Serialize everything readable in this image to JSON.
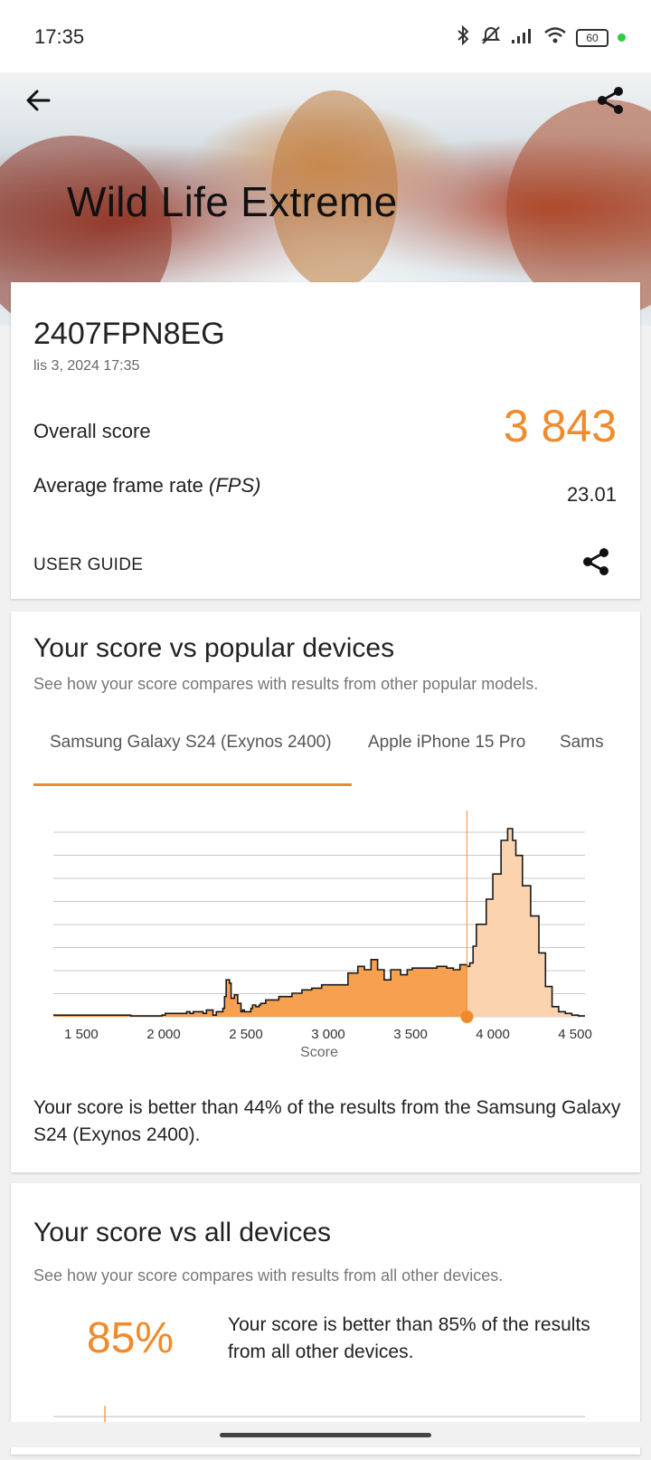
{
  "status_bar": {
    "time": "17:35",
    "battery": "60",
    "icons": [
      "bluetooth-icon",
      "mute-icon",
      "signal-icon",
      "wifi-icon",
      "battery-icon"
    ]
  },
  "header": {
    "title": "Wild Life Extreme",
    "back_icon": "arrow-left-icon",
    "share_icon": "share-icon"
  },
  "result": {
    "device": "2407FPN8EG",
    "date": "lis 3, 2024 17:35",
    "overall_label": "Overall score",
    "overall_value": "3 843",
    "fps_label": "Average frame rate",
    "fps_unit": "(FPS)",
    "fps_value": "23.01",
    "guide_label": "USER GUIDE"
  },
  "popular": {
    "title": "Your score vs popular devices",
    "subtitle": "See how your score compares with results from other popular models.",
    "tabs": [
      "Samsung Galaxy S24 (Exynos 2400)",
      "Apple iPhone 15 Pro",
      "Sams"
    ],
    "active_tab": 0,
    "compare_text": "Your score is better than 44% of the results from the Samsung Galaxy S24 (Exynos 2400)."
  },
  "all_devices": {
    "title": "Your score vs all devices",
    "subtitle": "See how your score compares with results from all other devices.",
    "percent": "85%",
    "text": "Your score is better than 85% of the results from all other devices."
  },
  "colors": {
    "accent": "#f08a2b",
    "fill_below": "#f7a04f",
    "fill_above": "#fbd3ae"
  },
  "chart_data": {
    "type": "area",
    "xlabel": "Score",
    "ylabel": "",
    "xlim": [
      1330,
      4560
    ],
    "ticks": [
      1500,
      2000,
      2500,
      3000,
      3500,
      4000,
      4500
    ],
    "tick_labels": [
      "1 500",
      "2 000",
      "2 500",
      "3 000",
      "3 500",
      "4 000",
      "4 500"
    ],
    "user_score": 3843,
    "grid": true,
    "x": [
      1330,
      1450,
      1780,
      1800,
      1990,
      2010,
      2120,
      2140,
      2160,
      2180,
      2240,
      2260,
      2300,
      2320,
      2350,
      2360,
      2370,
      2380,
      2400,
      2410,
      2430,
      2450,
      2470,
      2480,
      2490,
      2530,
      2540,
      2560,
      2580,
      2590,
      2600,
      2620,
      2660,
      2700,
      2740,
      2780,
      2840,
      2900,
      2960,
      3060,
      3120,
      3180,
      3220,
      3260,
      3300,
      3340,
      3380,
      3440,
      3480,
      3510,
      3560,
      3600,
      3660,
      3720,
      3760,
      3800,
      3843,
      3860,
      3880,
      3900,
      3960,
      4000,
      4050,
      4090,
      4120,
      4140,
      4180,
      4230,
      4280,
      4320,
      4360,
      4400,
      4440,
      4480,
      4520
    ],
    "y": [
      1,
      1,
      1,
      0.5,
      1,
      2,
      2,
      3,
      2,
      3,
      2,
      4,
      1,
      3,
      3,
      5,
      12,
      22,
      20,
      11,
      13,
      8,
      3,
      4,
      3,
      5,
      7,
      6,
      7,
      8,
      8,
      10,
      10,
      12,
      12,
      14,
      16,
      17,
      19,
      19,
      26,
      30,
      28,
      34,
      28,
      22,
      28,
      25,
      28,
      29,
      29,
      29,
      30,
      29,
      28,
      31,
      30,
      32,
      42,
      55,
      70,
      85,
      105,
      112,
      105,
      96,
      78,
      60,
      38,
      18,
      6,
      3,
      2,
      1,
      0.5
    ]
  }
}
